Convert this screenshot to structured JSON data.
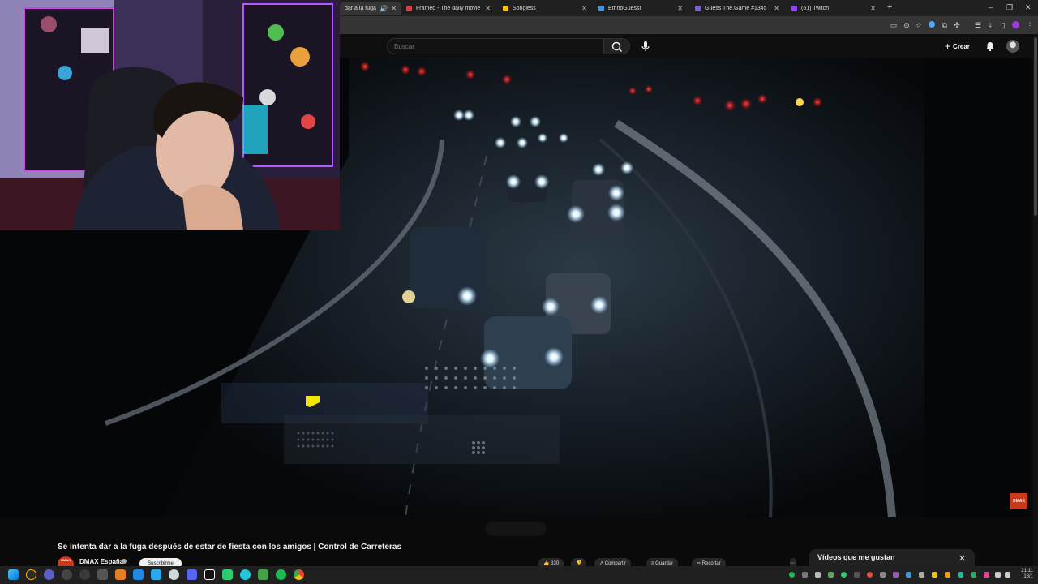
{
  "browser": {
    "tabs": [
      {
        "label": "dar a la fuga de",
        "favicon_color": "#ff0000",
        "active": true
      },
      {
        "label": "Framed - The daily movie gues",
        "favicon_color": "#e53935",
        "active": false
      },
      {
        "label": "Songless",
        "favicon_color": "#f5c400",
        "active": false
      },
      {
        "label": "EthnoGuessr",
        "favicon_color": "#4a90d9",
        "active": false
      },
      {
        "label": "Guess The.Game #1345",
        "favicon_color": "#7b5cd6",
        "active": false
      },
      {
        "label": "(51) Twitch",
        "favicon_color": "#9146ff",
        "active": false
      }
    ],
    "new_tab": "+",
    "window_controls": {
      "minimize": "–",
      "maximize": "❐",
      "close": "✕"
    }
  },
  "youtube": {
    "search": {
      "placeholder": "Buscar"
    },
    "create_label": "Crear"
  },
  "video": {
    "title": "Se intenta dar a la fuga después de estar de fiesta con los amigos | Control de Carreteras",
    "channel": "DMAX España",
    "channel_avatar_text": "DMAX",
    "subscribe_label": "Suscribirme",
    "watermark": "DMAX",
    "actions": {
      "likes": "330",
      "share": "Compartir",
      "save": "Guardar",
      "clip": "Recortar"
    }
  },
  "liked_panel": {
    "title": "Vídeos que me gustan",
    "close": "✕"
  },
  "taskbar": {
    "time": "21:11",
    "date": "18/1"
  },
  "colors": {
    "yt_background": "#0f0f0f",
    "accent_red": "#ff0000",
    "dmax_orange": "#c9391c",
    "taskbar": "#202020"
  }
}
